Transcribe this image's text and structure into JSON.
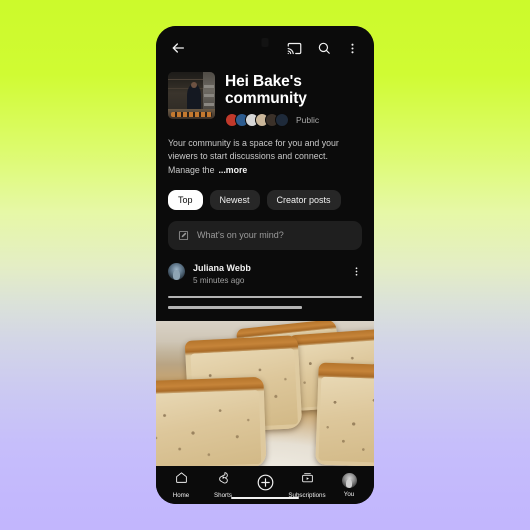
{
  "background": {
    "gradient_top": "#ccfa2b",
    "gradient_bottom": "#c2b6fd"
  },
  "phone": {
    "frame_color": "#000000",
    "screen_color": "#0b0b0b"
  },
  "appbar": {
    "back_icon": "back-arrow-icon",
    "cast_icon": "cast-icon",
    "search_icon": "search-icon",
    "overflow_icon": "more-vertical-icon",
    "camera_punch_hole": "camera-punch-hole"
  },
  "profile": {
    "thumbnail_alt": "channel-thumbnail-baker-in-kitchen",
    "name": "Hei Bake's community",
    "visibility": "Public",
    "member_avatars": [
      {
        "name": "member-avatar-1",
        "color": "#c0392b"
      },
      {
        "name": "member-avatar-2",
        "color": "#2d5c8f"
      },
      {
        "name": "member-avatar-3",
        "color": "#d7d7d7"
      },
      {
        "name": "member-avatar-4",
        "color": "#cbb79a"
      },
      {
        "name": "member-avatar-5",
        "color": "#3b3129"
      },
      {
        "name": "member-avatar-6",
        "color": "#1e2a3a"
      }
    ]
  },
  "description": {
    "text": "Your community is a space for you and your viewers to start discussions and connect. Manage the",
    "more_label": "...more"
  },
  "filter_chips": [
    {
      "label": "Top",
      "selected": true
    },
    {
      "label": "Newest",
      "selected": false
    },
    {
      "label": "Creator posts",
      "selected": false
    }
  ],
  "composer": {
    "icon": "compose-pencil-icon",
    "placeholder": "What's on your mind?",
    "value": ""
  },
  "post": {
    "avatar_alt": "post-author-avatar",
    "author": "Juliana Webb",
    "timestamp": "5 minutes ago",
    "overflow_icon": "more-vertical-icon",
    "body_placeholder_lines": [
      100,
      69
    ],
    "media_alt": "sliced-banana-bread-on-white-plate"
  },
  "bottom_nav": [
    {
      "label": "Home",
      "icon": "home-icon",
      "active": false
    },
    {
      "label": "Shorts",
      "icon": "shorts-icon",
      "active": false
    },
    {
      "label": "",
      "icon": "create-plus-icon",
      "active": false
    },
    {
      "label": "Subscriptions",
      "icon": "subscriptions-icon",
      "active": false
    },
    {
      "label": "You",
      "icon": "you-avatar-icon",
      "active": false
    }
  ],
  "system": {
    "gesture_bar": "home-gesture-bar"
  }
}
